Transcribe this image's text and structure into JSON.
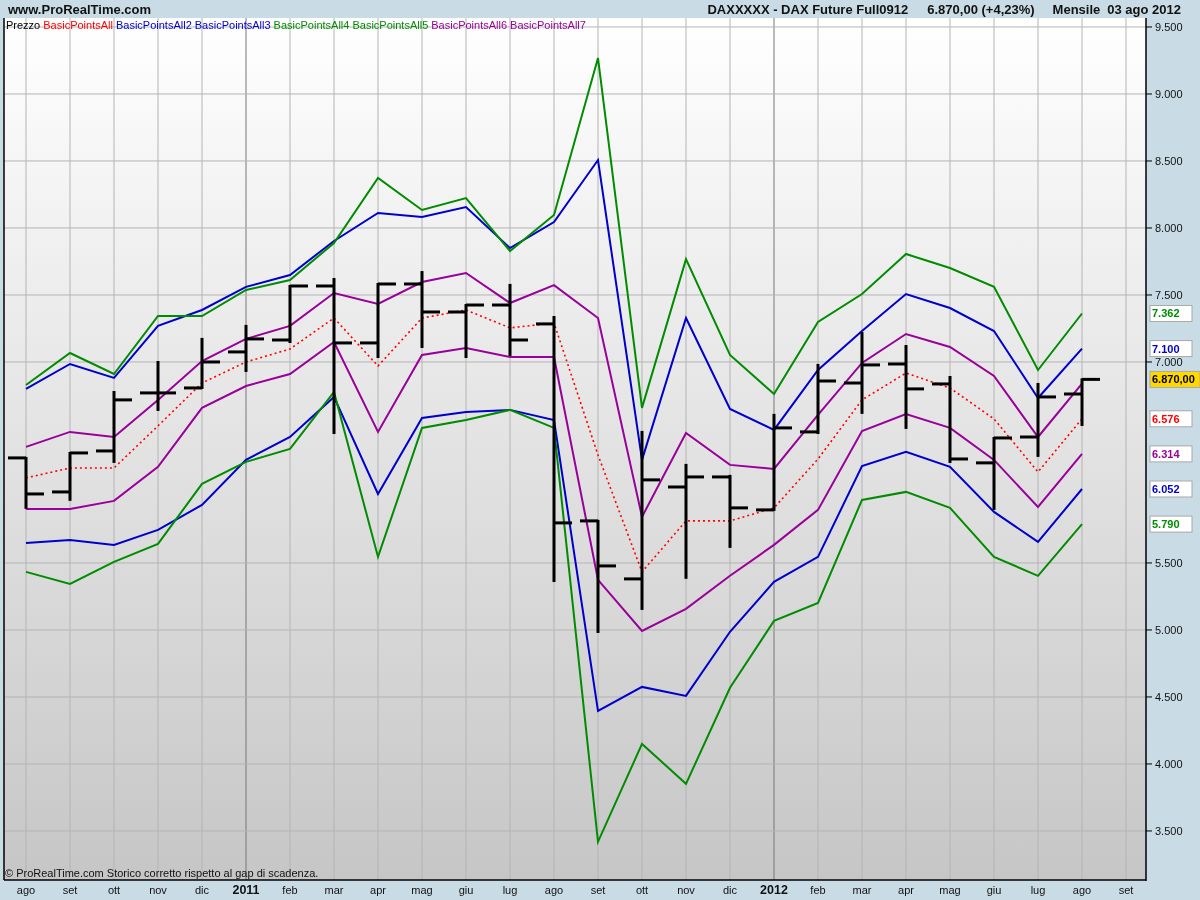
{
  "header": {
    "site": "www.ProRealTime.com",
    "instrument": "DAXXXXX - DAX Future Full0912",
    "price": "6.870,00 (+4,23%)",
    "period": "Mensile",
    "date": "03 ago 2012"
  },
  "chart": {
    "price_legend": {
      "label": "Prezzo",
      "color": "#000000"
    },
    "footnote": "© ProRealTime.com  Storico corretto rispetto al gap di scadenza.",
    "chart_data": {
      "type": "line",
      "grid": true,
      "categories": [
        "ago",
        "set",
        "ott",
        "nov",
        "dic",
        "2011",
        "feb",
        "mar",
        "apr",
        "mag",
        "giu",
        "lug",
        "ago",
        "set",
        "ott",
        "nov",
        "dic",
        "2012",
        "feb",
        "mar",
        "apr",
        "mag",
        "giu",
        "lug",
        "ago",
        "set"
      ],
      "ylim": [
        3134,
        9567
      ],
      "yticks": [
        {
          "value": 3500,
          "label": "3.500"
        },
        {
          "value": 4000,
          "label": "4.000"
        },
        {
          "value": 4500,
          "label": "4.500"
        },
        {
          "value": 5000,
          "label": "5.000"
        },
        {
          "value": 5500,
          "label": "5.500"
        },
        {
          "value": 7000,
          "label": "7.000"
        },
        {
          "value": 7500,
          "label": "7.500"
        },
        {
          "value": 8000,
          "label": "8.000"
        },
        {
          "value": 8500,
          "label": "8.500"
        },
        {
          "value": 9000,
          "label": "9.000"
        },
        {
          "value": 9500,
          "label": "9.500"
        }
      ],
      "series": [
        {
          "name": "BasicPointsAll",
          "color": "#ff0000",
          "line_style": "dotted",
          "values": [
            6135,
            6209,
            6209,
            6523,
            6843,
            7000,
            7097,
            7328,
            6970,
            7328,
            7388,
            7254,
            7291,
            6306,
            5433,
            5814,
            5814,
            5911,
            6276,
            6717,
            6918,
            6806,
            6575,
            6179,
            6576,
            null
          ]
        },
        {
          "name": "BasicPointsAll2",
          "color": "#0000cc",
          "line_style": "solid",
          "values": [
            6799,
            6985,
            6881,
            7269,
            7388,
            7560,
            7649,
            7903,
            8112,
            8082,
            8156,
            7850,
            8044,
            8507,
            6269,
            7328,
            6649,
            6493,
            6940,
            7231,
            7507,
            7403,
            7231,
            6731,
            7100,
            null
          ]
        },
        {
          "name": "BasicPointsAll3",
          "color": "#0000cc",
          "line_style": "solid",
          "values": [
            5650,
            5672,
            5635,
            5747,
            5933,
            6269,
            6441,
            6739,
            6015,
            6582,
            6627,
            6642,
            6567,
            4396,
            4575,
            4508,
            4986,
            5359,
            5545,
            6224,
            6329,
            6217,
            5881,
            5657,
            6052,
            null
          ]
        },
        {
          "name": "BasicPointsAll4",
          "color": "#008c00",
          "line_style": "solid",
          "values": [
            6828,
            7067,
            6910,
            7343,
            7343,
            7537,
            7612,
            7888,
            8373,
            8134,
            8223,
            7828,
            8097,
            9268,
            6657,
            7768,
            7052,
            6761,
            7298,
            7507,
            7806,
            7701,
            7560,
            6940,
            7362,
            null
          ]
        },
        {
          "name": "BasicPointsAll5",
          "color": "#008c00",
          "line_style": "solid",
          "values": [
            5433,
            5344,
            5508,
            5642,
            6090,
            6254,
            6351,
            6776,
            5545,
            6508,
            6567,
            6642,
            6508,
            3419,
            4150,
            3852,
            4568,
            5068,
            5202,
            5971,
            6030,
            5911,
            5545,
            5404,
            5790,
            null
          ]
        },
        {
          "name": "BasicPointsAll6",
          "color": "#990099",
          "line_style": "solid",
          "values": [
            6366,
            6478,
            6440,
            6717,
            7007,
            7172,
            7269,
            7515,
            7433,
            7597,
            7664,
            7440,
            7574,
            7328,
            5844,
            6470,
            6232,
            6202,
            6605,
            6993,
            7209,
            7112,
            6896,
            6440,
            6838,
            null
          ]
        },
        {
          "name": "BasicPointsAll7",
          "color": "#990099",
          "line_style": "solid",
          "values": [
            5903,
            5903,
            5963,
            6217,
            6657,
            6821,
            6910,
            7149,
            6478,
            7052,
            7104,
            7037,
            7037,
            5374,
            4993,
            5157,
            5404,
            5635,
            5896,
            6485,
            6612,
            6508,
            6269,
            5918,
            6314,
            null
          ]
        }
      ]
    },
    "price_tags": [
      {
        "label": "7.362",
        "color": "#008c00",
        "kind": "level"
      },
      {
        "label": "7.100",
        "color": "#0000cc",
        "kind": "level"
      },
      {
        "label": "6.870,00",
        "kind": "current"
      },
      {
        "label": "6.576",
        "color": "#ff0000",
        "kind": "level"
      },
      {
        "label": "6.314",
        "color": "#990099",
        "kind": "level"
      },
      {
        "label": "6.052",
        "color": "#0000cc",
        "kind": "level"
      },
      {
        "label": "5.790",
        "color": "#008c00",
        "kind": "level"
      }
    ]
  }
}
